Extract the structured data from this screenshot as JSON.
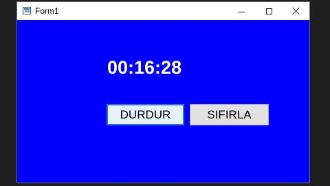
{
  "window": {
    "title": "Form1",
    "background_color": "#0000ff",
    "icon": "form-app-icon"
  },
  "title_controls": {
    "minimize": "minimize-icon",
    "maximize": "maximize-icon",
    "close": "close-icon"
  },
  "timer": {
    "display": "00:16:28"
  },
  "buttons": {
    "stop_label": "DURDUR",
    "reset_label": "SIFIRLA"
  }
}
